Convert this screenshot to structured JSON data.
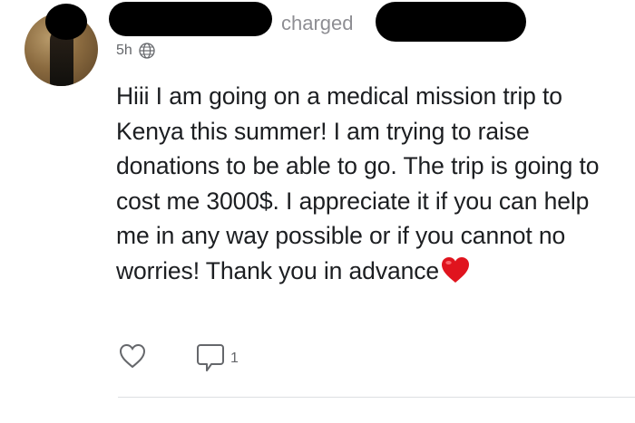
{
  "post": {
    "author_visible": "charged",
    "timestamp": "5h",
    "visibility_icon": "globe-icon",
    "body_text": "Hiii I am going on a medical mission trip to Kenya this summer! I am trying to raise donations to be able to go. The trip is going to cost me 3000$. I appreciate it if you can help me in any way possible or if you cannot no worries! Thank you in advance",
    "emoji": "red-heart-emoji"
  },
  "actions": {
    "like_icon": "heart-outline-icon",
    "comment_icon": "comment-bubble-icon",
    "comment_count": "1"
  },
  "colors": {
    "text": "#1c1e21",
    "secondary_text": "#65676b",
    "header_text": "#8e8e93",
    "divider": "#dddfe2",
    "emoji_red": "#e0141e"
  }
}
